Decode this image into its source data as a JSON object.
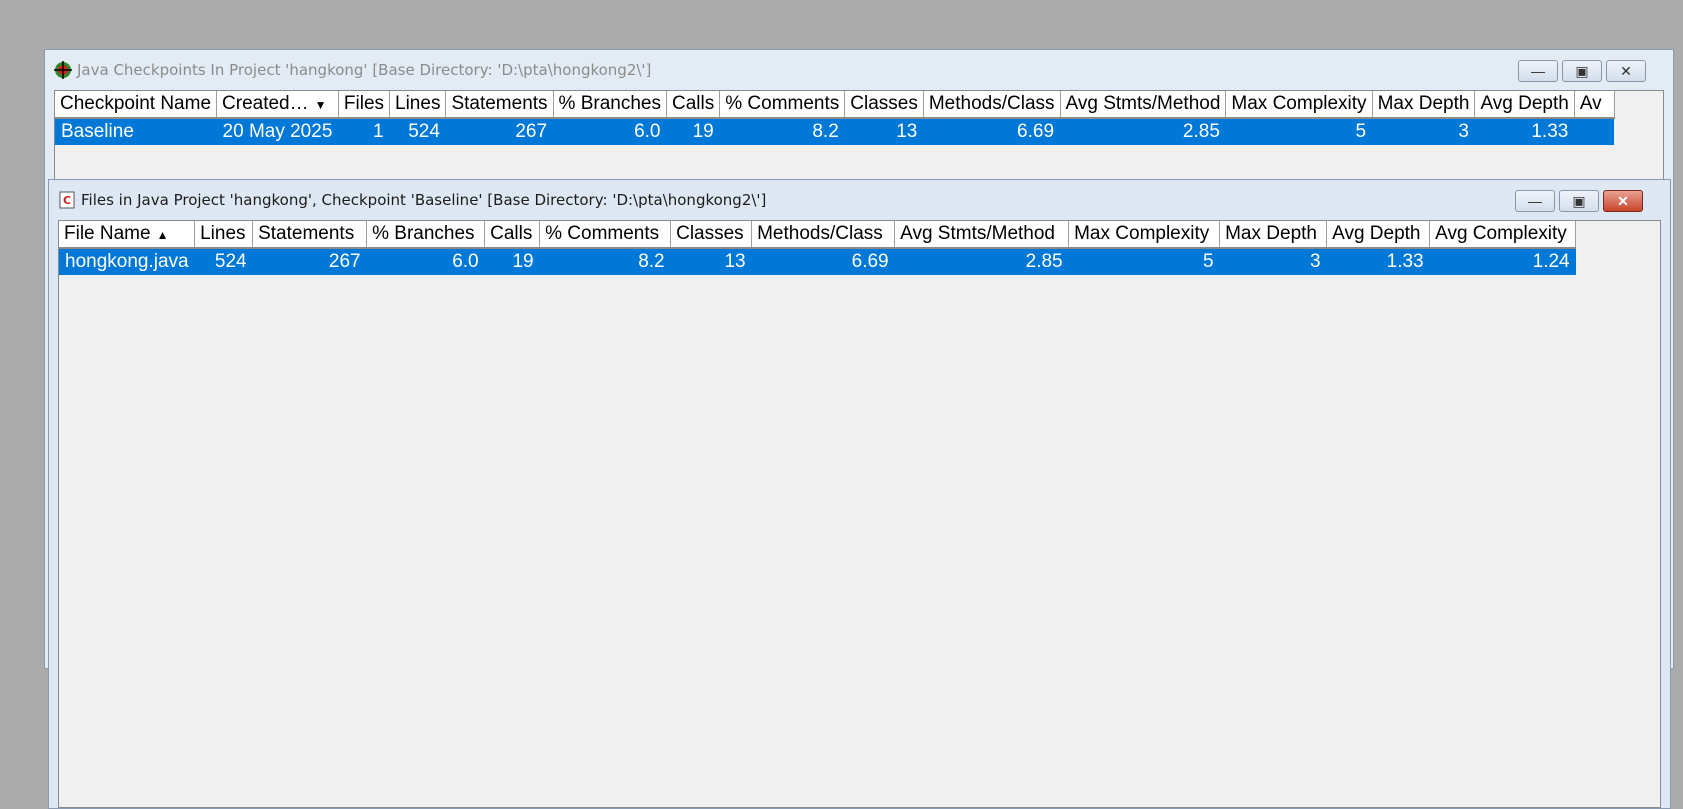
{
  "checkpoints_window": {
    "title": "Java Checkpoints In Project 'hangkong'  [Base Directory: 'D:\\pta\\hongkong2\\']",
    "title_icon": "checkpoint-target-icon",
    "columns": [
      "Checkpoint Name",
      "Created…",
      "Files",
      "Lines",
      "Statements",
      "% Branches",
      "Calls",
      "% Comments",
      "Classes",
      "Methods/Class",
      "Avg Stmts/Method",
      "Max Complexity",
      "Max Depth",
      "Avg Depth",
      "Av"
    ],
    "sort_indicator": "descending-arrow",
    "rows": [
      {
        "selected": true,
        "cells": [
          "Baseline",
          "20 May 2025",
          "1",
          "524",
          "267",
          "6.0",
          "19",
          "8.2",
          "13",
          "6.69",
          "2.85",
          "5",
          "3",
          "1.33",
          ""
        ]
      }
    ]
  },
  "files_window": {
    "title": "Files in Java Project 'hangkong', Checkpoint 'Baseline'  [Base Directory: 'D:\\pta\\hongkong2\\']",
    "title_icon": "java-file-icon",
    "columns": [
      "File Name",
      "Lines",
      "Statements",
      "% Branches",
      "Calls",
      "% Comments",
      "Classes",
      "Methods/Class",
      "Avg Stmts/Method",
      "Max Complexity",
      "Max Depth",
      "Avg Depth",
      "Avg Complexity"
    ],
    "sort_indicator": "ascending-arrow",
    "rows": [
      {
        "selected": true,
        "cells": [
          "hongkong.java",
          "524",
          "267",
          "6.0",
          "19",
          "8.2",
          "13",
          "6.69",
          "2.85",
          "5",
          "3",
          "1.33",
          "1.24"
        ]
      }
    ]
  },
  "colors": {
    "selection": "#0078d7",
    "desktop": "#ababab",
    "close_button": "#c8442c"
  }
}
